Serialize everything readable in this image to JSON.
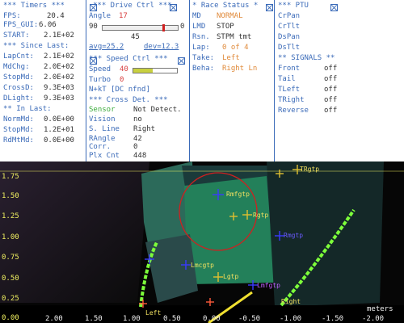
{
  "timers": {
    "header": "*** Timers ***",
    "fps_label": "FPS:",
    "fps": "20.4",
    "fpsgui_label": "FPS_GUI:",
    "fpsgui": "6.06",
    "start_label": "START:",
    "start": "2.1E+02",
    "since_header": "*** Since Last:",
    "rows": [
      {
        "label": "LapCnt:",
        "value": "2.1E+02"
      },
      {
        "label": "MdChg:",
        "value": "2.0E+02"
      },
      {
        "label": "StopMd:",
        "value": "2.0E+02"
      },
      {
        "label": "CrossD:",
        "value": "9.3E+03"
      },
      {
        "label": "DLight:",
        "value": "9.3E+03"
      }
    ],
    "in_header": "** In Last:",
    "in_rows": [
      {
        "label": "NormMd:",
        "value": "0.0E+00"
      },
      {
        "label": "StopMd:",
        "value": "1.2E+01"
      },
      {
        "label": "RdMtMd:",
        "value": "0.0E+00"
      }
    ]
  },
  "drive": {
    "header": "*** Drive Ctrl ***",
    "angle_label": "Angle",
    "angle": "17",
    "slider_min": "90",
    "slider_max": "0",
    "slider_fraction": 0.82,
    "center_value": "45",
    "avg": "avg=25.2",
    "dev": "dev=12.3",
    "speed_header": "*** Speed Ctrl ***",
    "speed_label": "Speed",
    "speed": "40",
    "speed_fraction": 0.45,
    "turbo_label": "Turbo",
    "turbo": "0",
    "nkt": "N+kT [DC nfnd]",
    "cross_header": "*** Cross Det. ***",
    "cross_rows": [
      {
        "label": "Sensor",
        "value": "Not Detect."
      },
      {
        "label": "Vision",
        "value": "no"
      },
      {
        "label": "S. Line",
        "value": "Right"
      },
      {
        "label": "RAngle",
        "value": "42"
      },
      {
        "label": "Corr.",
        "value": "0"
      },
      {
        "label": "Plx Cnt",
        "value": "448"
      }
    ]
  },
  "race": {
    "header": "* Race Status *",
    "rows": [
      {
        "label": "MD",
        "value": "NORMAL"
      },
      {
        "label": "LMD",
        "value": "STOP"
      },
      {
        "label": "Rsn.",
        "value": "STPM tmt"
      },
      {
        "label": "Lap:",
        "value": "0 of 4"
      },
      {
        "label": "Take:",
        "value": "Left"
      },
      {
        "label": "Beha:",
        "value": "Right Ln"
      }
    ]
  },
  "ptu": {
    "header": "*** PTU",
    "items": [
      "CrPan",
      "CrTlt",
      "DsPan",
      "DsTlt"
    ],
    "signals_header": "** SIGNALS **",
    "signals": [
      {
        "label": "Front",
        "value": "off"
      },
      {
        "label": "Tail",
        "value": "off"
      },
      {
        "label": "TLeft",
        "value": "off"
      },
      {
        "label": "TRight",
        "value": "off"
      },
      {
        "label": "Reverse",
        "value": "off"
      }
    ]
  },
  "camera": {
    "y_ticks": [
      "1.75",
      "1.50",
      "1.25",
      "1.00",
      "0.75",
      "0.50",
      "0.25",
      "0.00"
    ],
    "x_ticks": [
      "2.00",
      "1.50",
      "1.00",
      "0.50",
      "0.00",
      "-0.50",
      "-1.00",
      "-1.50",
      "-2.00"
    ],
    "units": "meters",
    "markers": [
      {
        "label": "TRgtp"
      },
      {
        "label": "Rmfgtp"
      },
      {
        "label": "Rgtp"
      },
      {
        "label": "Rmgtp"
      },
      {
        "label": "Lmcgtp"
      },
      {
        "label": "Lgtp"
      },
      {
        "label": "Lmfgtp"
      },
      {
        "label": "Left"
      },
      {
        "label": "Right"
      }
    ],
    "colors": {
      "track_line": "#7dff3a",
      "circle": "#d02020",
      "marker": "#3a3aff",
      "label": "#f0e060"
    }
  }
}
